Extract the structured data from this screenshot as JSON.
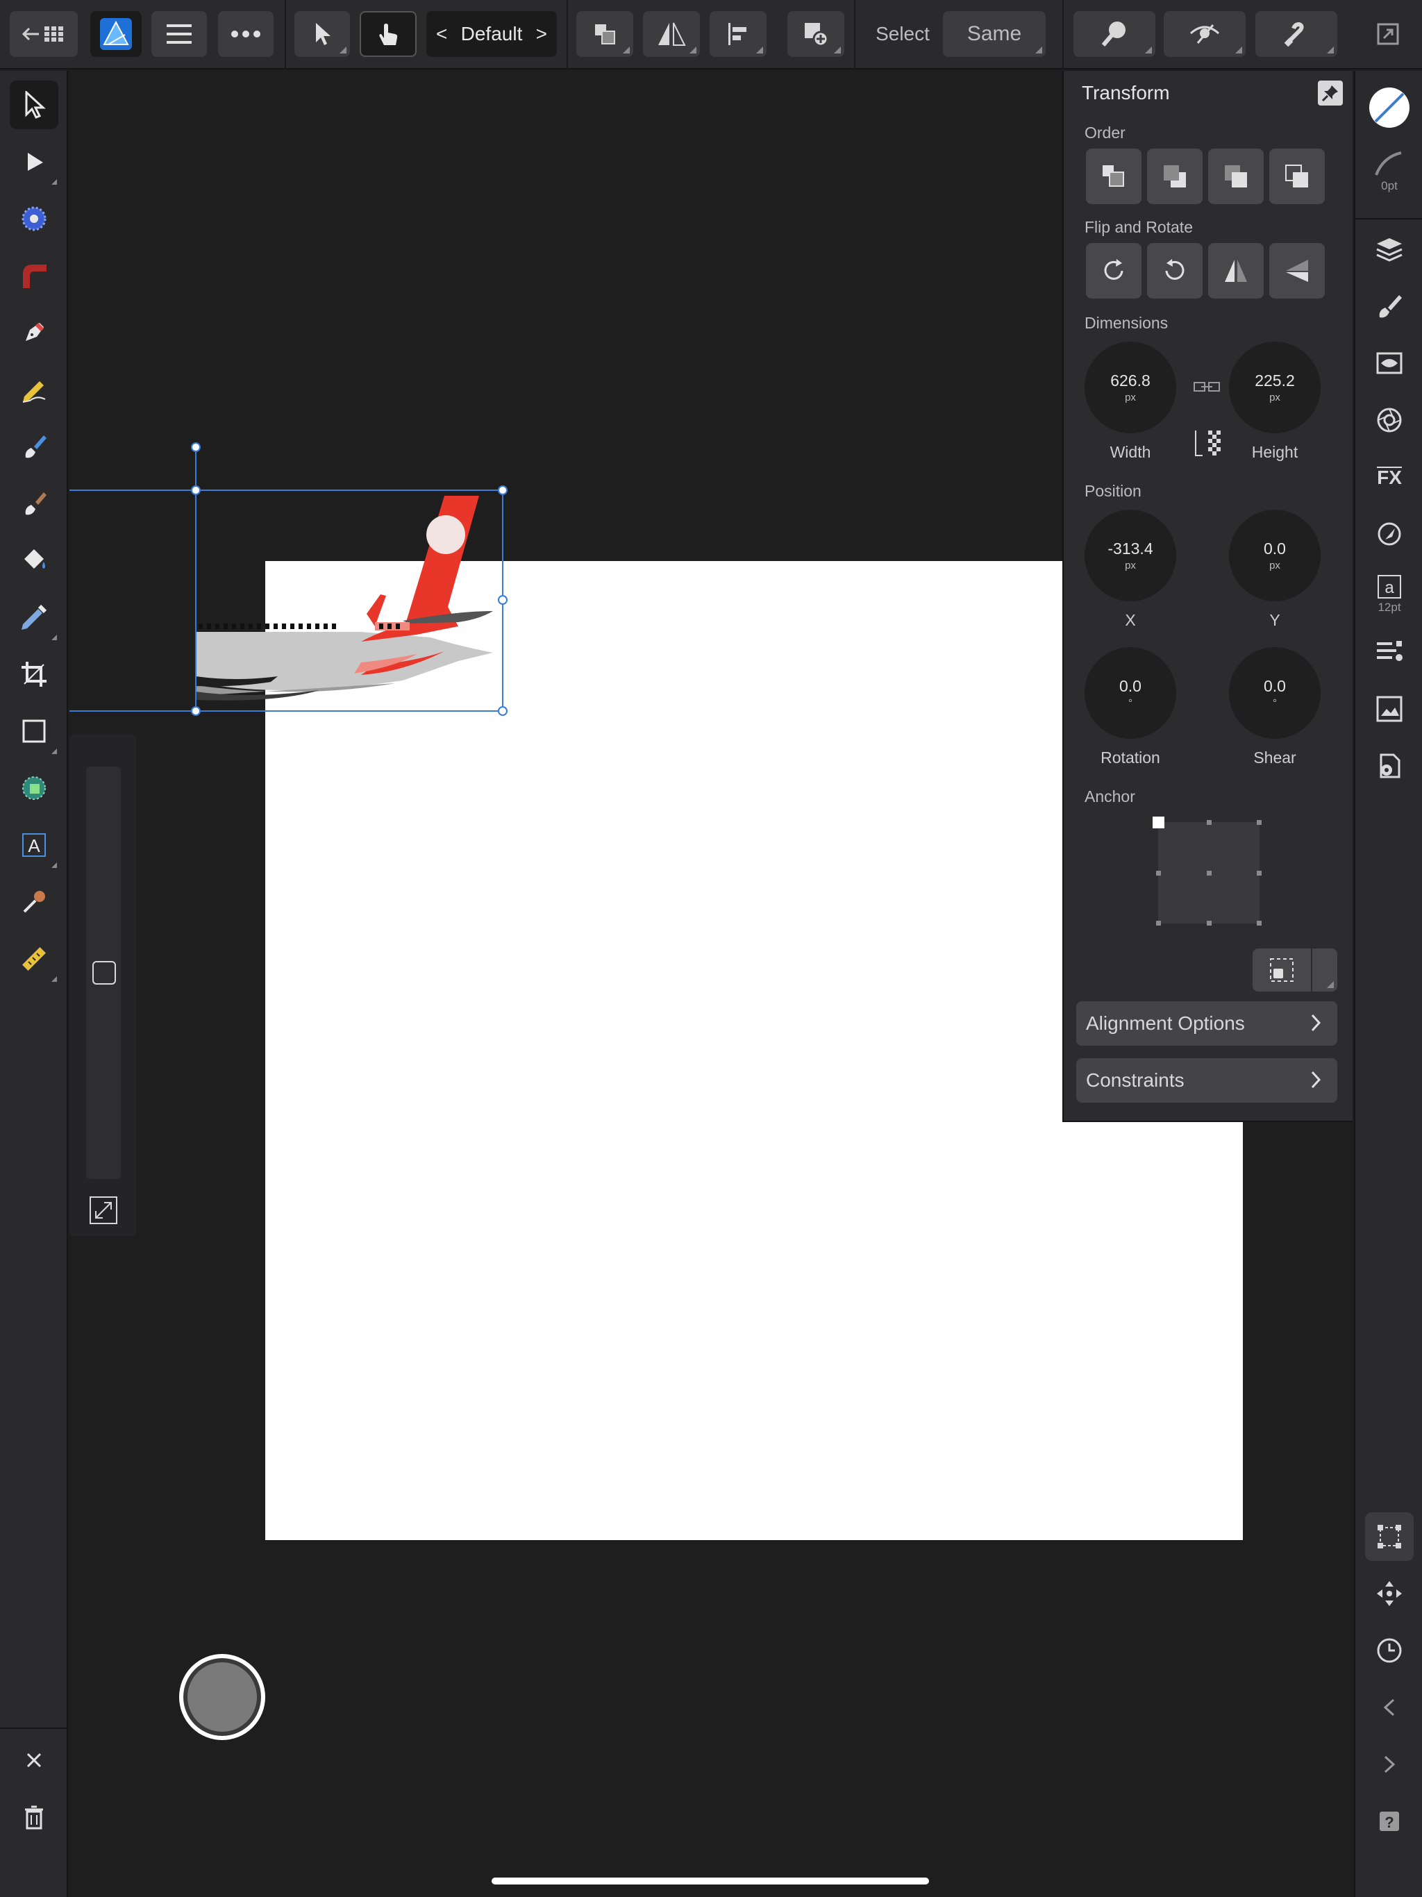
{
  "toolbar": {
    "context_label": "Default",
    "select_label": "Select",
    "same_label": "Same"
  },
  "transform_panel": {
    "title": "Transform",
    "order_label": "Order",
    "flip_rotate_label": "Flip and Rotate",
    "dimensions_label": "Dimensions",
    "width": {
      "value": "626.8",
      "unit": "px",
      "label": "Width"
    },
    "height": {
      "value": "225.2",
      "unit": "px",
      "label": "Height"
    },
    "position_label": "Position",
    "x": {
      "value": "-313.4",
      "unit": "px",
      "label": "X"
    },
    "y": {
      "value": "0.0",
      "unit": "px",
      "label": "Y"
    },
    "rotation": {
      "value": "0.0",
      "unit": "°",
      "label": "Rotation"
    },
    "shear": {
      "value": "0.0",
      "unit": "°",
      "label": "Shear"
    },
    "anchor_label": "Anchor",
    "alignment_options_label": "Alignment Options",
    "constraints_label": "Constraints"
  },
  "studio": {
    "stroke_width": "0pt",
    "text_size": "12pt"
  },
  "colors": {
    "accent_blue": "#4a90e2",
    "selection_blue": "#3a7bd5",
    "livery_red": "#e8362a"
  }
}
